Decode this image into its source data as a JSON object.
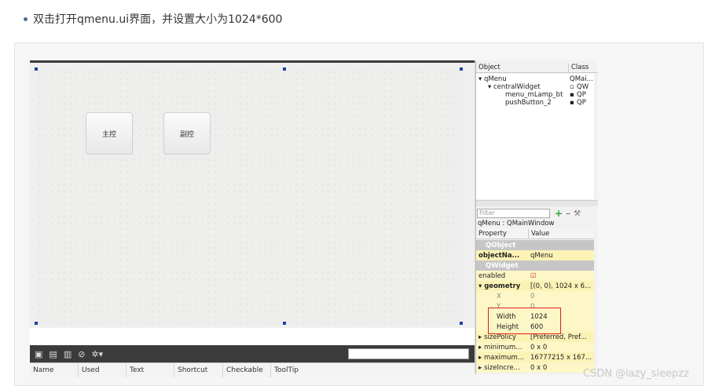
{
  "instruction": "双击打开qmenu.ui界面，并设置大小为1024*600",
  "form_buttons": [
    "主控",
    "副控"
  ],
  "action_editor": {
    "toolbar_icons": [
      "new-action-icon",
      "copy-icon",
      "paste-icon",
      "delete-icon",
      "settings-icon"
    ],
    "columns": [
      "Name",
      "Used",
      "Text",
      "Shortcut",
      "Checkable",
      "ToolTip"
    ]
  },
  "object_inspector": {
    "columns": [
      "Object",
      "Class"
    ],
    "tree": [
      {
        "name": "▾ qMenu",
        "class": "QMai..."
      },
      {
        "name": "▾ centralWidget",
        "class": "QW"
      },
      {
        "name": "menu_mLamp_bt",
        "class": "QP"
      },
      {
        "name": "pushButton_2",
        "class": "QP"
      }
    ]
  },
  "property_editor": {
    "filter_placeholder": "Filter",
    "title": "qMenu : QMainWindow",
    "columns": [
      "Property",
      "Value"
    ],
    "rows": [
      {
        "name": "QObject",
        "value": ""
      },
      {
        "name": "objectNa...",
        "value": "qMenu"
      },
      {
        "name": "QWidget",
        "value": ""
      },
      {
        "name": "enabled",
        "value": "☑"
      },
      {
        "name": "▾ geometry",
        "value": "[(0, 0), 1024 x 6..."
      },
      {
        "name": "X",
        "value": "0"
      },
      {
        "name": "Y",
        "value": "0"
      },
      {
        "name": "Width",
        "value": "1024"
      },
      {
        "name": "Height",
        "value": "600"
      },
      {
        "name": "▸ sizePolicy",
        "value": "[Preferred, Pref..."
      },
      {
        "name": "▸ minimum...",
        "value": "0 x 0"
      },
      {
        "name": "▸ maximum...",
        "value": "16777215 x 167..."
      },
      {
        "name": "▸ sizeIncre...",
        "value": "0 x 0"
      }
    ]
  },
  "watermark": "CSDN @lazy_sleepzz",
  "colors": {
    "highlight_box": "#e02020",
    "property_yellow": "#fdf6c6",
    "section_gray": "#c6c6c6"
  }
}
